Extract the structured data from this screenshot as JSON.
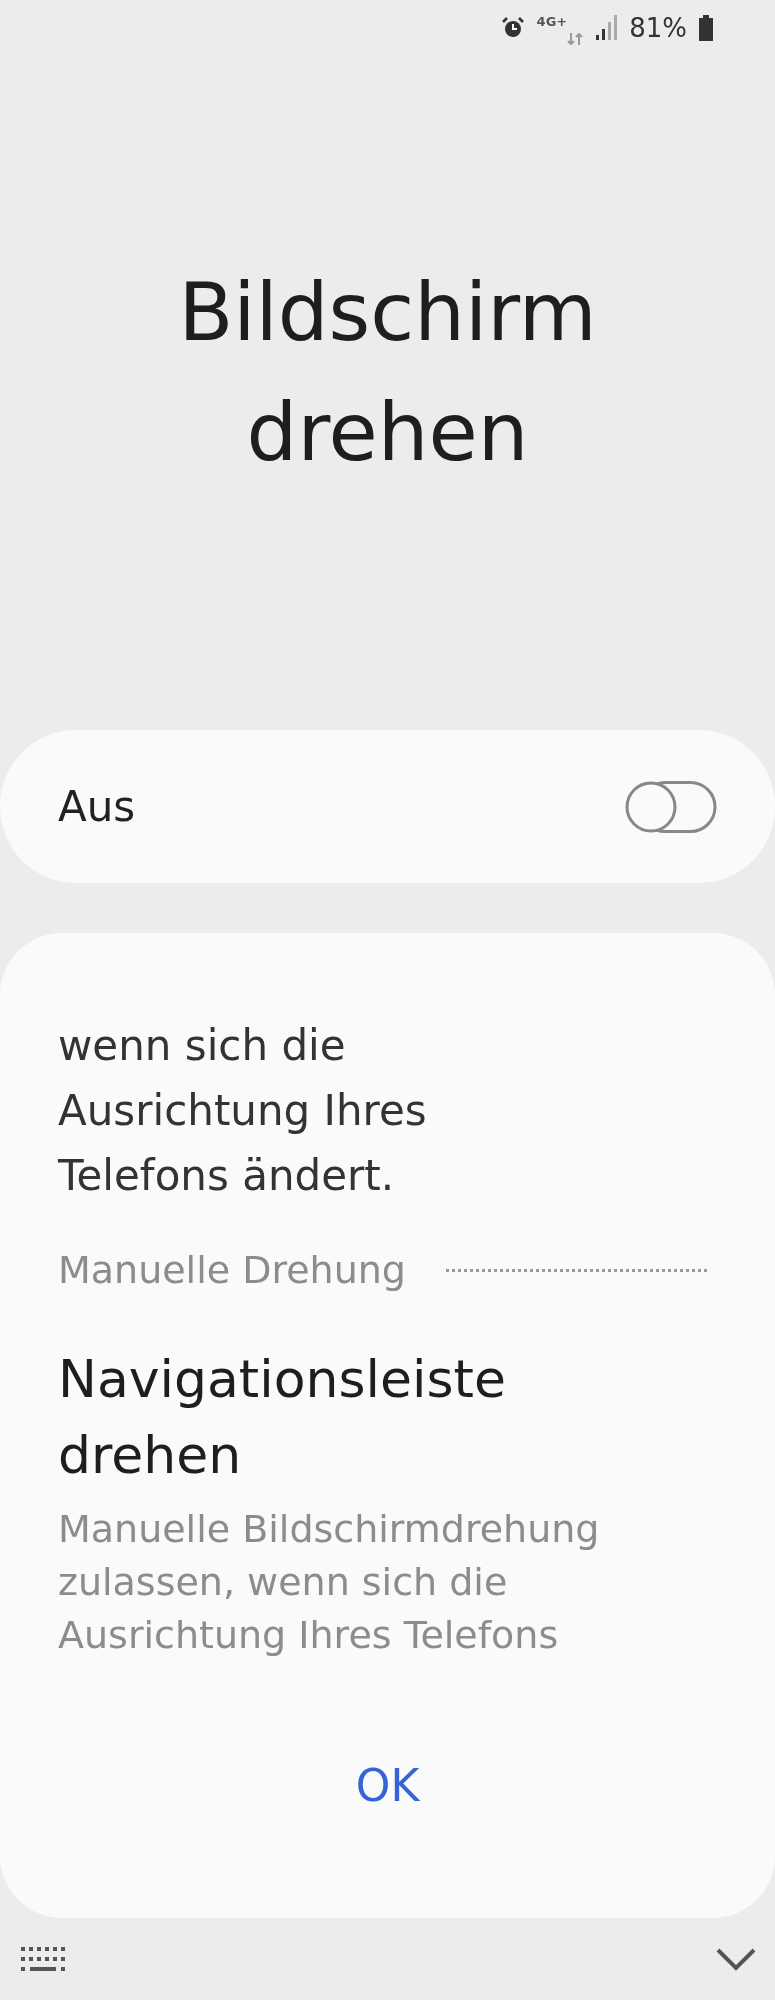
{
  "status_bar": {
    "network": "4G+",
    "battery": "81%"
  },
  "title": "Bildschirm drehen",
  "master_toggle": {
    "label": "Aus",
    "on": false
  },
  "dialog": {
    "text_top": "wenn sich die Ausrichtung Ihres Telefons ändert.",
    "section_label": "Manuelle Drehung",
    "option": {
      "title": "Navigationsleiste drehen",
      "description": "Manuelle Bildschirmdrehung zulassen, wenn sich die Ausrichtung Ihres Telefons"
    },
    "ok": "OK"
  }
}
